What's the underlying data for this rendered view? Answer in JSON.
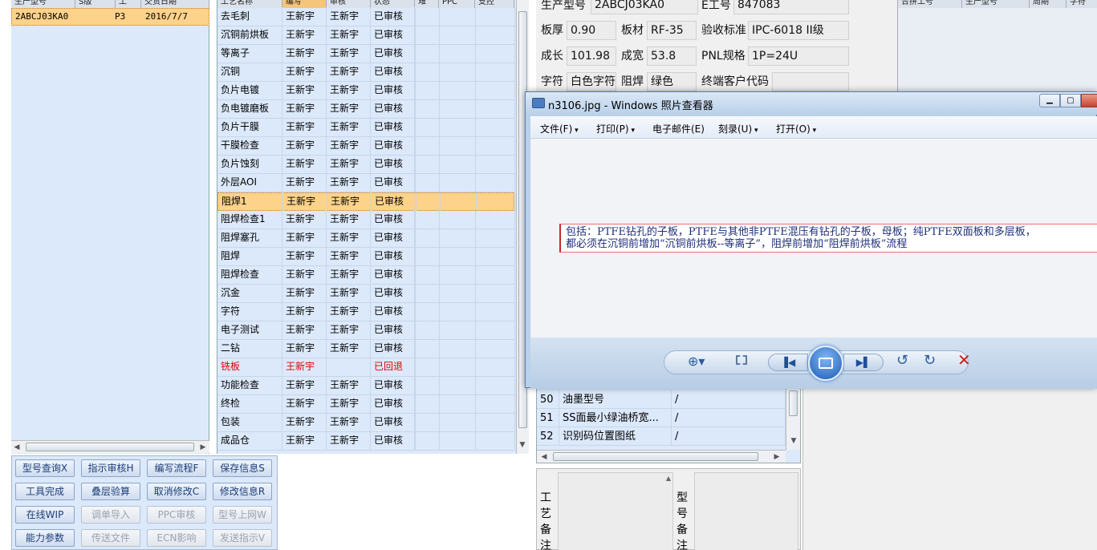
{
  "left_grid": {
    "headers": [
      "生产型号",
      "S版",
      "工",
      "交货日期"
    ],
    "row": {
      "model": "2ABCJ03KA0",
      "version": "P3",
      "due_date": "2016/7/7"
    }
  },
  "process_grid": {
    "headers": [
      "工艺名称",
      "编写",
      "审核",
      "状态",
      "难",
      "PPC",
      "支控"
    ],
    "rows": [
      {
        "name": "去毛刺",
        "writer": "王新宇",
        "reviewer": "王新宇",
        "status": "已审核"
      },
      {
        "name": "沉铜前烘板",
        "writer": "王新宇",
        "reviewer": "王新宇",
        "status": "已审核"
      },
      {
        "name": "等离子",
        "writer": "王新宇",
        "reviewer": "王新宇",
        "status": "已审核"
      },
      {
        "name": "沉铜",
        "writer": "王新宇",
        "reviewer": "王新宇",
        "status": "已审核"
      },
      {
        "name": "负片电镀",
        "writer": "王新宇",
        "reviewer": "王新宇",
        "status": "已审核"
      },
      {
        "name": "负电镀磨板",
        "writer": "王新宇",
        "reviewer": "王新宇",
        "status": "已审核"
      },
      {
        "name": "负片干膜",
        "writer": "王新宇",
        "reviewer": "王新宇",
        "status": "已审核"
      },
      {
        "name": "干膜检查",
        "writer": "王新宇",
        "reviewer": "王新宇",
        "status": "已审核"
      },
      {
        "name": "负片蚀刻",
        "writer": "王新宇",
        "reviewer": "王新宇",
        "status": "已审核"
      },
      {
        "name": "外层AOI",
        "writer": "王新宇",
        "reviewer": "王新宇",
        "status": "已审核"
      },
      {
        "name": "阻焊1",
        "writer": "王新宇",
        "reviewer": "王新宇",
        "status": "已审核"
      },
      {
        "name": "阻焊检查1",
        "writer": "王新宇",
        "reviewer": "王新宇",
        "status": "已审核"
      },
      {
        "name": "阻焊塞孔",
        "writer": "王新宇",
        "reviewer": "王新宇",
        "status": "已审核"
      },
      {
        "name": "阻焊",
        "writer": "王新宇",
        "reviewer": "王新宇",
        "status": "已审核"
      },
      {
        "name": "阻焊检查",
        "writer": "王新宇",
        "reviewer": "王新宇",
        "status": "已审核"
      },
      {
        "name": "沉金",
        "writer": "王新宇",
        "reviewer": "王新宇",
        "status": "已审核"
      },
      {
        "name": "字符",
        "writer": "王新宇",
        "reviewer": "王新宇",
        "status": "已审核"
      },
      {
        "name": "电子测试",
        "writer": "王新宇",
        "reviewer": "王新宇",
        "status": "已审核"
      },
      {
        "name": "二钻",
        "writer": "王新宇",
        "reviewer": "王新宇",
        "status": "已审核"
      },
      {
        "name": "铣板",
        "writer": "王新宇",
        "reviewer": "",
        "status": "已回退"
      },
      {
        "name": "功能检查",
        "writer": "王新宇",
        "reviewer": "王新宇",
        "status": "已审核"
      },
      {
        "name": "终检",
        "writer": "王新宇",
        "reviewer": "王新宇",
        "status": "已审核"
      },
      {
        "name": "包装",
        "writer": "王新宇",
        "reviewer": "王新宇",
        "status": "已审核"
      },
      {
        "name": "成品仓",
        "writer": "王新宇",
        "reviewer": "王新宇",
        "status": "已审核"
      }
    ]
  },
  "buttons": [
    {
      "label": "型号查询X",
      "enabled": true
    },
    {
      "label": "指示审核H",
      "enabled": true
    },
    {
      "label": "编写流程F",
      "enabled": true
    },
    {
      "label": "保存信息S",
      "enabled": true
    },
    {
      "label": "工具完成",
      "enabled": true
    },
    {
      "label": "叠层验算",
      "enabled": true
    },
    {
      "label": "取消修改C",
      "enabled": true
    },
    {
      "label": "修改信息R",
      "enabled": true
    },
    {
      "label": "在线WIP",
      "enabled": true
    },
    {
      "label": "调单导入",
      "enabled": false
    },
    {
      "label": "PPC审核",
      "enabled": false
    },
    {
      "label": "型号上网W",
      "enabled": false
    },
    {
      "label": "能力参数",
      "enabled": true
    },
    {
      "label": "传送文件",
      "enabled": false
    },
    {
      "label": "ECN影响",
      "enabled": false
    },
    {
      "label": "发送指示V",
      "enabled": false
    }
  ],
  "info": {
    "model_label": "生产型号",
    "model_value": "2ABCJ03KA0",
    "e_label": "E工号",
    "e_value": "847083",
    "thickness_label": "板厚",
    "thickness_value": "0.90",
    "material_label": "板材",
    "material_value": "RF-35",
    "standard_label": "验收标准",
    "standard_value": "IPC-6018 II级",
    "length_label": "成长",
    "length_value": "101.98",
    "width_label": "成宽",
    "width_value": "53.8",
    "pnl_label": "PNL规格",
    "pnl_value": "1P=24U",
    "char_label": "字符",
    "char_value": "白色字符",
    "mask_label": "阻焊",
    "mask_value": "绿色",
    "customer_label": "终端客户代码",
    "customer_value": ""
  },
  "right_grid": {
    "headers": [
      "合拼工号",
      "生产型号",
      "周期",
      "字符"
    ]
  },
  "params_list": [
    {
      "num": "50",
      "name": "油墨型号",
      "value": "/"
    },
    {
      "num": "51",
      "name": "SS面最小绿油桥宽...",
      "value": "/"
    },
    {
      "num": "52",
      "name": "识别码位置图纸",
      "value": "/"
    }
  ],
  "remarks": {
    "process_label": "工艺备注",
    "model_label": "型号备注"
  },
  "viewer": {
    "title": "n3106.jpg - Windows 照片查看器",
    "menu": [
      "文件(F)",
      "打印(P)",
      "电子邮件(E)",
      "刻录(U)",
      "打开(O)"
    ],
    "line1": "包括：PTFE钻孔的子板，PTFE与其他非PTFE混压有钻孔的子板，母板；纯PTFE双面板和多层板，",
    "line2": "都必须在沉铜前增加“沉铜前烘板--等离子”，阻焊前增加“阻焊前烘板”流程"
  },
  "colors": {
    "grid_bg": "#dce9fb",
    "selected_row": "#fdd28a",
    "rejected": "#e00000",
    "viewer_accent": "#2e6fc4"
  }
}
